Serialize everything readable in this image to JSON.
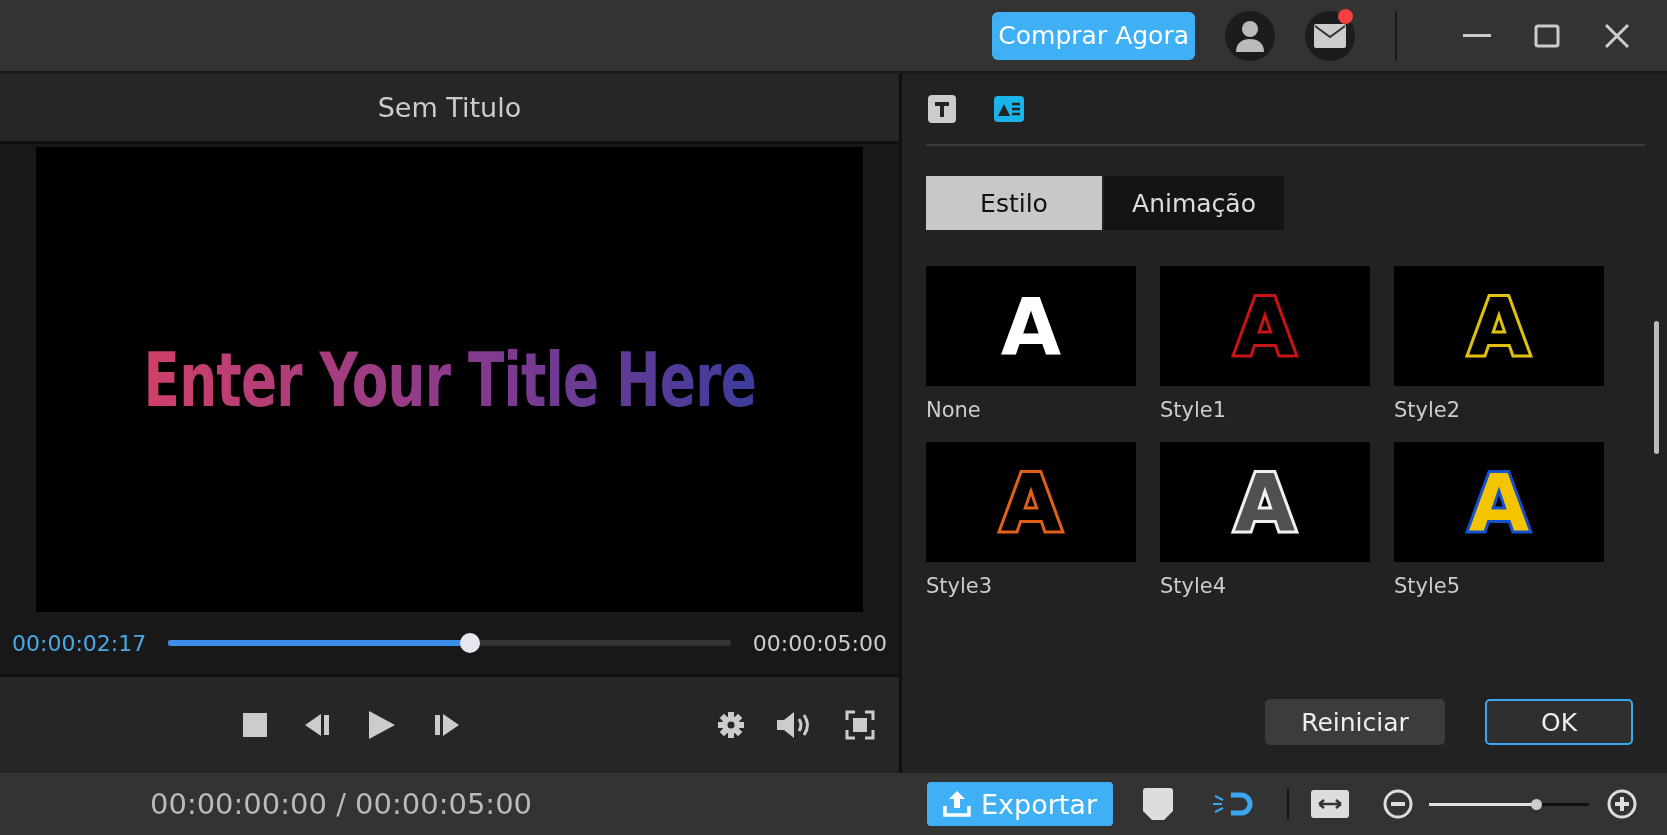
{
  "top_bar": {
    "buy_button": "Comprar Agora",
    "mail_unread": true
  },
  "preview": {
    "title": "Sem Titulo",
    "video_text": "Enter Your Title Here",
    "current_time": "00:00:02:17",
    "total_time": "00:00:05:00",
    "progress": {
      "level": 0.536
    }
  },
  "panel": {
    "icon_tabs": [
      {
        "kind": "text",
        "selected": false
      },
      {
        "kind": "style",
        "selected": true
      }
    ],
    "tabs": [
      {
        "label": "Estilo",
        "selected": true
      },
      {
        "label": "Animação",
        "selected": false
      }
    ],
    "styles": [
      {
        "label": "None",
        "letter": "A",
        "kind": "plain"
      },
      {
        "label": "Style1",
        "letter": "A",
        "kind": "ruby"
      },
      {
        "label": "Style2",
        "letter": "A",
        "kind": "gold"
      },
      {
        "label": "Style3",
        "letter": "A",
        "kind": "ember"
      },
      {
        "label": "Style4",
        "letter": "A",
        "kind": "silver"
      },
      {
        "label": "Style5",
        "letter": "A",
        "kind": "royal"
      }
    ],
    "buttons": [
      {
        "label": "Reiniciar",
        "kind": "secondary"
      },
      {
        "label": "OK",
        "kind": "primary"
      }
    ]
  },
  "bottom_bar": {
    "timecode": "00:00:00:00 / 00:00:05:00",
    "export_button": "Exportar",
    "zoom": {
      "level": 0.67
    }
  }
}
